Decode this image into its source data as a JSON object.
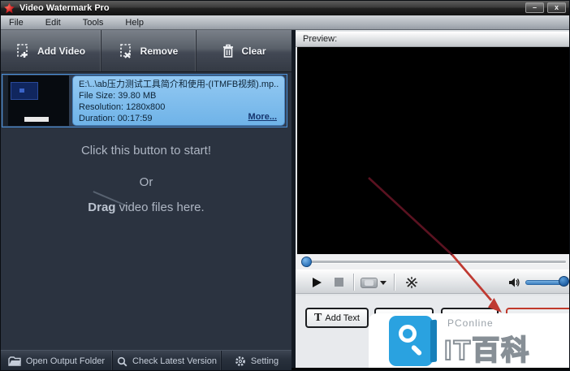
{
  "titlebar": {
    "title": "Video Watermark Pro",
    "minimize": "–",
    "close": "x"
  },
  "menubar": {
    "items": [
      "File",
      "Edit",
      "Tools",
      "Help"
    ]
  },
  "toolbar": {
    "add_video": "Add Video",
    "remove": "Remove",
    "clear": "Clear"
  },
  "list": {
    "item": {
      "filename": "E:\\..\\ab压力测试工具简介和使用-(ITMFB视频).mp..",
      "file_size": "File Size: 39.80 MB",
      "resolution": "Resolution: 1280x800",
      "duration": "Duration: 00:17:59",
      "more": "More..."
    },
    "hint1": "Click this button to start!",
    "hint2": "Or",
    "hint3_bold": "Drag",
    "hint3_rest": " video files here."
  },
  "statusbar": {
    "open_output": "Open Output Folder",
    "check_version": "Check Latest Version",
    "setting": "Setting"
  },
  "preview": {
    "label": "Preview:"
  },
  "edit_buttons": {
    "add_text_glyph": "T",
    "add_text": "Add Text"
  },
  "watermark": {
    "brand": "PConline",
    "title": "IT百科"
  },
  "colors": {
    "selection_blue": "#7fc0ee",
    "logo_blue": "#2aa2e0",
    "arrow_red": "#bf3a32",
    "red_button_border": "#c0392b"
  }
}
